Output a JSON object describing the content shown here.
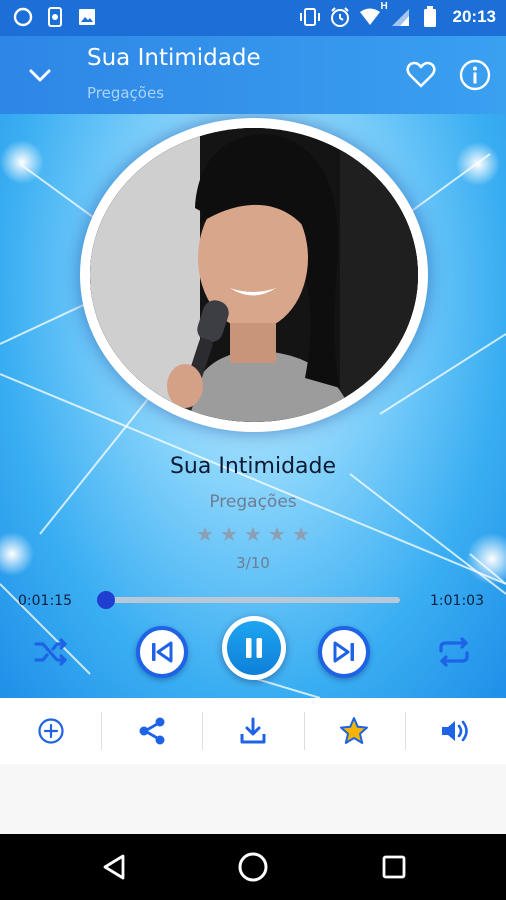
{
  "status_bar": {
    "time": "20:13",
    "network_label": "H",
    "icons": [
      "circle-icon",
      "phone-sync-icon",
      "image-icon",
      "vibrate-icon",
      "alarm-icon",
      "wifi-icon",
      "signal-icon",
      "battery-icon"
    ]
  },
  "toolbar": {
    "title": "Sua Intimidade",
    "subtitle": "Pregações",
    "back_icon": "chevron-down-icon",
    "favorite_icon": "heart-outline-icon",
    "info_icon": "info-icon"
  },
  "track": {
    "title": "Sua Intimidade",
    "category": "Pregações",
    "rating": 0,
    "rating_max": 5,
    "counter": "3/10"
  },
  "progress": {
    "current": "0:01:15",
    "total": "1:01:03",
    "fraction": 0.02
  },
  "controls": {
    "shuffle_icon": "shuffle-icon",
    "prev_icon": "skip-previous-icon",
    "play_state": "playing",
    "play_icon": "pause-icon",
    "next_icon": "skip-next-icon",
    "repeat_icon": "repeat-icon"
  },
  "actions": [
    {
      "name": "add-playlist",
      "icon": "add-circle-icon"
    },
    {
      "name": "share",
      "icon": "share-icon"
    },
    {
      "name": "download",
      "icon": "download-icon"
    },
    {
      "name": "rate",
      "icon": "star-icon"
    },
    {
      "name": "volume",
      "icon": "volume-icon"
    }
  ],
  "colors": {
    "primary": "#1d6fd8",
    "accent": "#1e63e6",
    "star": "#f4b400",
    "text_dark": "#0c1a33",
    "text_muted": "#6d7d93"
  }
}
